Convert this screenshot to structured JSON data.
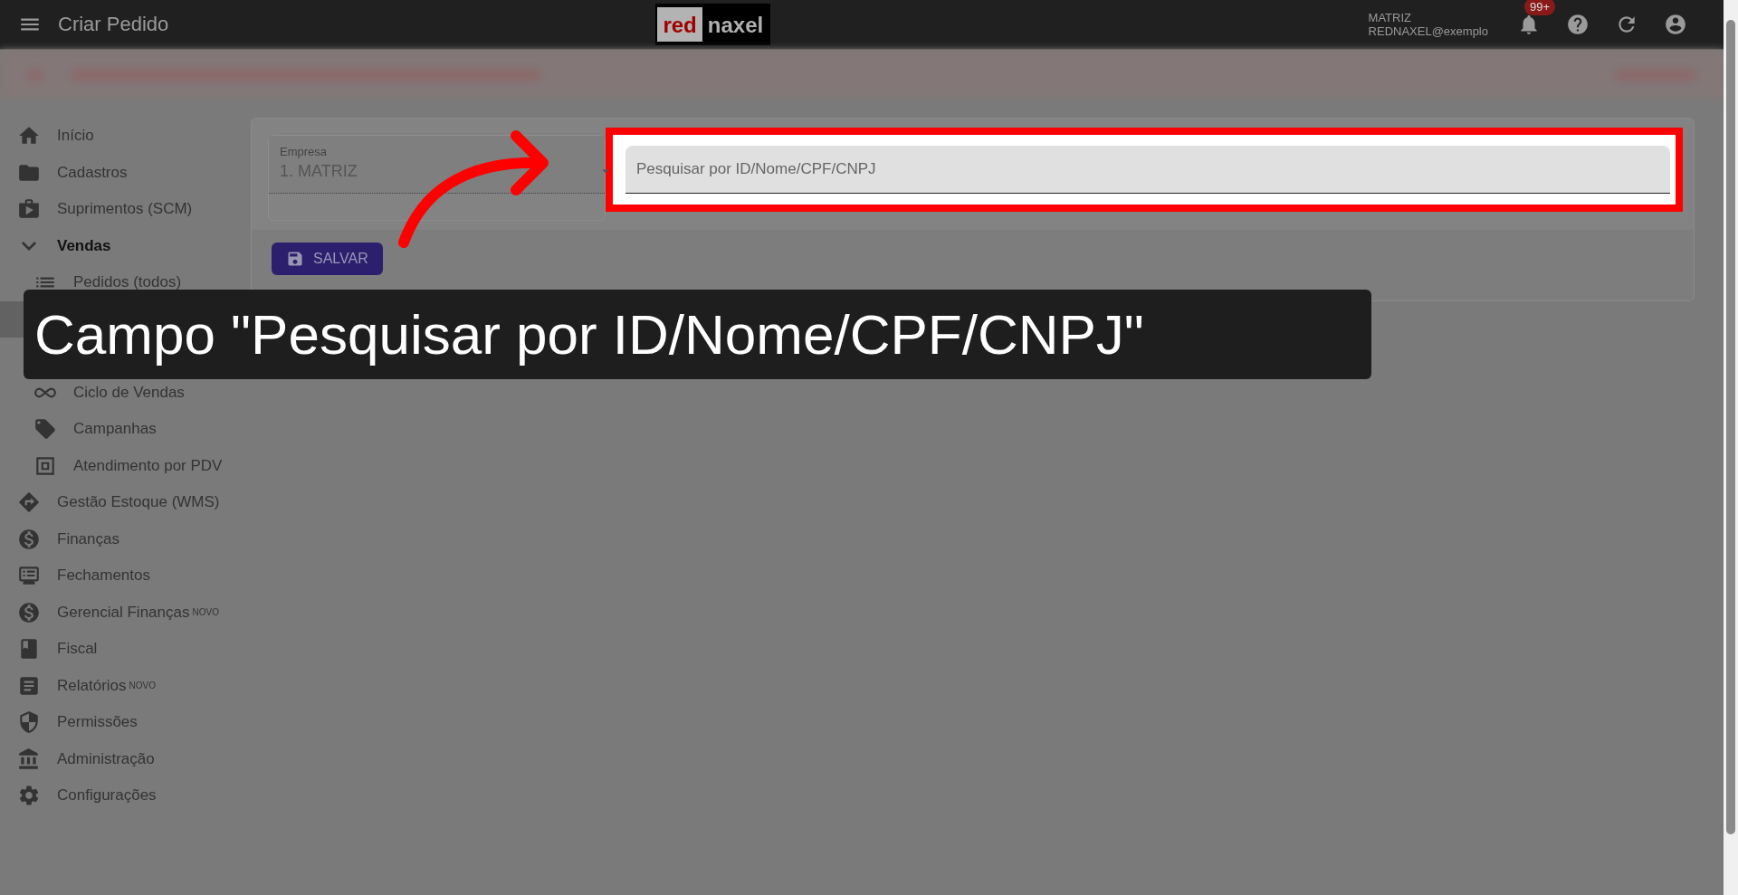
{
  "top_bar": {
    "title": "Criar Pedido",
    "logo": {
      "part_1": "red",
      "part_2": "naxel"
    },
    "user": {
      "company": "MATRIZ",
      "login": "REDNAXEL@exemplo"
    },
    "notifications_badge": "99+"
  },
  "sidebar": {
    "items": [
      {
        "label": "Início",
        "kind": "item"
      },
      {
        "label": "Cadastros",
        "kind": "item"
      },
      {
        "label": "Suprimentos (SCM)",
        "kind": "item"
      },
      {
        "label": "Vendas",
        "kind": "group",
        "expanded": true,
        "children": [
          {
            "label": "Pedidos (todos)",
            "kind": "item",
            "selected": false
          },
          {
            "kind": "covered",
            "selected": true
          },
          {
            "kind": "covered",
            "selected": false
          },
          {
            "label": "Ciclo de Vendas",
            "kind": "item",
            "selected": false
          },
          {
            "label": "Campanhas",
            "kind": "item",
            "selected": false
          },
          {
            "label": "Atendimento por PDV",
            "kind": "item",
            "selected": false
          }
        ]
      },
      {
        "label": "Gestão Estoque (WMS)",
        "kind": "item"
      },
      {
        "label": "Finanças",
        "kind": "item"
      },
      {
        "label": "Fechamentos",
        "kind": "item"
      },
      {
        "label": "Gerencial Finanças",
        "kind": "item",
        "badge": "NOVO"
      },
      {
        "label": "Fiscal",
        "kind": "item"
      },
      {
        "label": "Relatórios",
        "kind": "item",
        "badge": "NOVO"
      },
      {
        "label": "Permissões",
        "kind": "item"
      },
      {
        "label": "Administração",
        "kind": "item"
      },
      {
        "label": "Configurações",
        "kind": "item"
      }
    ]
  },
  "form": {
    "company_select": {
      "label": "Empresa",
      "value": "1. MATRIZ"
    },
    "search_field": {
      "placeholder": "Pesquisar por ID/Nome/CPF/CNPJ",
      "highlighted": true
    },
    "save_button": "SALVAR"
  },
  "caption": "Campo \"Pesquisar por ID/Nome/CPF/CNPJ\""
}
